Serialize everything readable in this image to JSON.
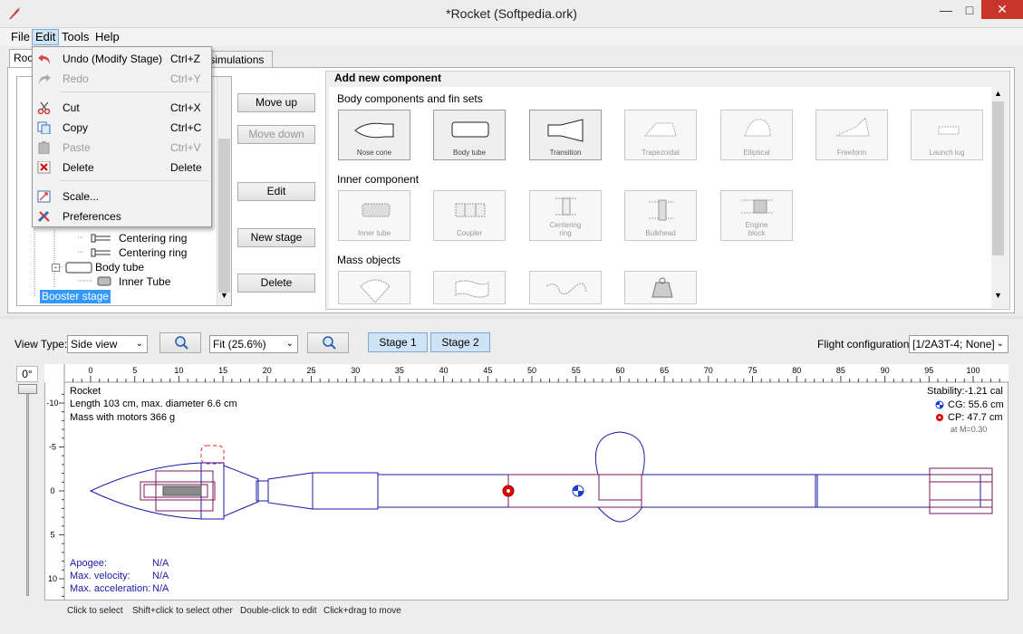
{
  "window": {
    "title": "*Rocket (Softpedia.ork)",
    "minimize_icon": "minimize-icon",
    "maximize_icon": "maximize-icon",
    "close_icon": "close-icon",
    "close_color": "#c7352b"
  },
  "menu": {
    "file": "File",
    "edit": "Edit",
    "tools": "Tools",
    "help": "Help"
  },
  "edit_menu": [
    {
      "label": "Undo (Modify Stage)",
      "shortcut": "Ctrl+Z",
      "enabled": true,
      "icon": "undo-icon"
    },
    {
      "label": "Redo",
      "shortcut": "Ctrl+Y",
      "enabled": false,
      "icon": "redo-icon"
    },
    {
      "label": "Cut",
      "shortcut": "Ctrl+X",
      "enabled": true,
      "icon": "scissors-icon"
    },
    {
      "label": "Copy",
      "shortcut": "Ctrl+C",
      "enabled": true,
      "icon": "copy-icon"
    },
    {
      "label": "Paste",
      "shortcut": "Ctrl+V",
      "enabled": false,
      "icon": "paste-icon"
    },
    {
      "label": "Delete",
      "shortcut": "Delete",
      "enabled": true,
      "icon": "delete-icon"
    },
    {
      "label": "Scale...",
      "shortcut": "",
      "enabled": true,
      "icon": "scale-icon"
    },
    {
      "label": "Preferences",
      "shortcut": "",
      "enabled": true,
      "icon": "preferences-icon"
    }
  ],
  "tabs": {
    "design": "Roc",
    "simulations": "nt simulations"
  },
  "tree": {
    "items": [
      "Centering ring",
      "Centering ring",
      "Body tube",
      "Inner Tube",
      "Booster stage"
    ]
  },
  "actions": {
    "move_up": "Move up",
    "move_down": "Move down",
    "edit": "Edit",
    "new_stage": "New stage",
    "delete": "Delete"
  },
  "add_component": {
    "title": "Add new component",
    "body_section": "Body components and fin sets",
    "body": [
      "Nose cone",
      "Body tube",
      "Transition",
      "Trapezoidal",
      "Elliptical",
      "Freeform",
      "Launch lug"
    ],
    "inner_section": "Inner component",
    "inner": [
      "Inner tube",
      "Coupler",
      "Centering\nring",
      "Bulkhead",
      "Engine\nblock"
    ],
    "mass_section": "Mass objects"
  },
  "view": {
    "type_label": "View Type:",
    "type_value": "Side view",
    "zoom_value": "Fit (25.6%)",
    "stage1": "Stage 1",
    "stage2": "Stage 2",
    "flight_config_label": "Flight configuration:",
    "flight_config_value": "[1/2A3T-4; None]",
    "angle": "0°",
    "unit": "cm"
  },
  "ruler": {
    "top_labels": [
      "0",
      "5",
      "10",
      "15",
      "20",
      "25",
      "30",
      "35",
      "40",
      "45",
      "50",
      "55",
      "60",
      "65",
      "70",
      "75",
      "80",
      "85",
      "90",
      "95",
      "100"
    ],
    "left_labels": [
      "-10",
      "-5",
      "0",
      "5",
      "10"
    ]
  },
  "rocket_info": {
    "name": "Rocket",
    "length": "Length 103 cm, max. diameter 6.6 cm",
    "mass": "Mass with motors 366 g",
    "stability": "Stability:-1.21 cal",
    "cg": "CG: 55.6 cm",
    "cp": "CP: 47.7 cm",
    "mach": "at M=0.30"
  },
  "flight": {
    "apogee_label": "Apogee:",
    "apogee": "N/A",
    "velocity_label": "Max. velocity:",
    "velocity": "N/A",
    "accel_label": "Max. acceleration:",
    "accel": "N/A"
  },
  "hints": [
    "Click to select",
    "Shift+click to select other",
    "Double-click to edit",
    "Click+drag to move"
  ],
  "colors": {
    "rocket_outline": "#1a1aa8",
    "motor_outline": "#7a1a5a",
    "cp": "#e00000",
    "cg": "#1a3fd1",
    "selection": "#3399ff"
  }
}
